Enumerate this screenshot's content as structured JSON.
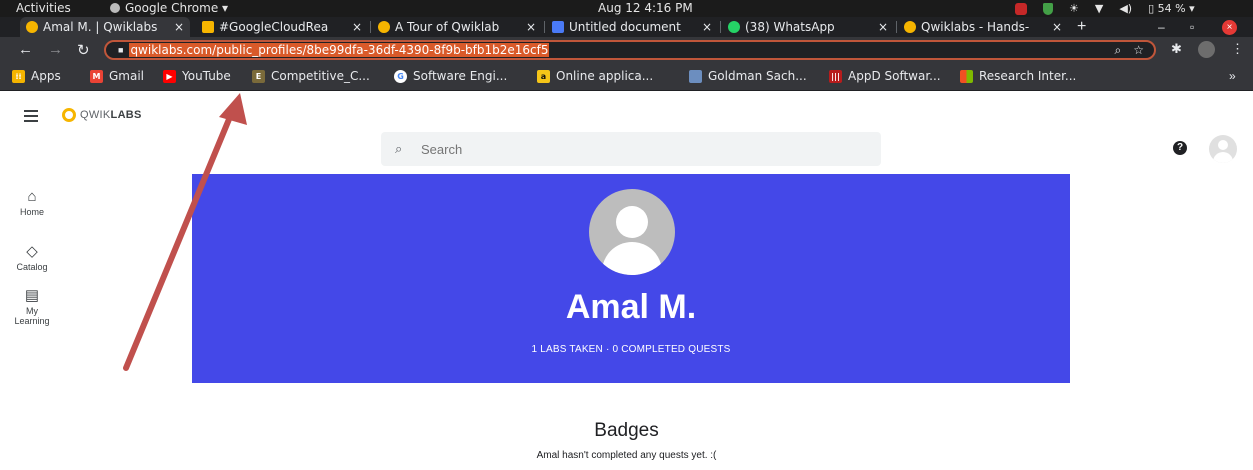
{
  "os_bar": {
    "activities": "Activities",
    "app_name": "Google Chrome ▾",
    "clock": "Aug 12  4:16 PM",
    "battery": "54 % ▾"
  },
  "tabs": [
    {
      "title": "Amal M. | Qwiklabs",
      "favicon": "qwiklabs-icon",
      "active": true
    },
    {
      "title": "#GoogleCloudRea",
      "favicon": "google-sheets-icon",
      "active": false
    },
    {
      "title": "A Tour of Qwiklab",
      "favicon": "qwiklabs-icon",
      "active": false
    },
    {
      "title": "Untitled document",
      "favicon": "google-docs-icon",
      "active": false
    },
    {
      "title": "(38) WhatsApp",
      "favicon": "whatsapp-icon",
      "active": false
    },
    {
      "title": "Qwiklabs - Hands-",
      "favicon": "qwiklabs-icon",
      "active": false
    }
  ],
  "omnibox": {
    "url": "qwiklabs.com/public_profiles/8be99dfa-36df-4390-8f9b-bfb1b2e16cf5"
  },
  "bookmarks": [
    {
      "label": "Apps",
      "icon": "apps-grid-icon",
      "color": "#f4b400"
    },
    {
      "label": "Gmail",
      "icon": "gmail-icon",
      "color": "#ea4335"
    },
    {
      "label": "YouTube",
      "icon": "youtube-icon",
      "color": "#ff0000"
    },
    {
      "label": "Competitive_C...",
      "icon": "bookmark-icon",
      "color": "#7a6a3a"
    },
    {
      "label": "Software Engi...",
      "icon": "google-icon",
      "color": "#4285f4"
    },
    {
      "label": "Online applica...",
      "icon": "amazon-icon",
      "color": "#f5c518"
    },
    {
      "label": "Goldman Sach...",
      "icon": "doc-icon",
      "color": "#6c8ebf"
    },
    {
      "label": "AppD Softwar...",
      "icon": "cisco-icon",
      "color": "#b71c1c"
    },
    {
      "label": "Research Inter...",
      "icon": "microsoft-icon",
      "color": "#f25022"
    }
  ],
  "site": {
    "logo_prefix": "QWIK",
    "logo_suffix": "LABS",
    "search_placeholder": "Search",
    "help_glyph": "?",
    "rail": [
      {
        "label": "Home",
        "icon": "home-icon"
      },
      {
        "label": "Catalog",
        "icon": "catalog-icon"
      },
      {
        "label": "My Learning",
        "icon": "my-learning-icon"
      }
    ]
  },
  "profile": {
    "name": "Amal M.",
    "stats": "1 LABS TAKEN · 0 COMPLETED QUESTS",
    "hero_color": "#4448e8"
  },
  "badges": {
    "title": "Badges",
    "empty_message": "Amal hasn't completed any quests yet. :("
  },
  "annotation": {
    "arrow_color": "#c0504d"
  }
}
